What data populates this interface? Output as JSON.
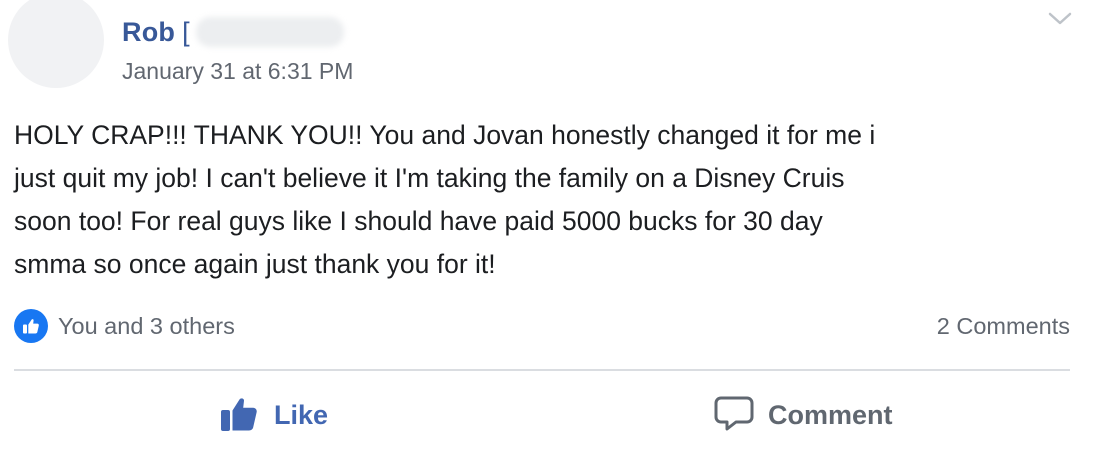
{
  "post": {
    "author_name": "Rob",
    "author_name_suffix": "[",
    "timestamp": "January 31 at 6:31 PM",
    "text": "HOLY CRAP!!! THANK YOU!! You and Jovan honestly changed it for me i\njust quit my job! I can't believe it I'm taking the family on a Disney Cruis\nsoon too! For real guys like I should have paid 5000 bucks for 30 day\nsmma so once again just thank you for it!",
    "reactions_text": "You and 3 others",
    "comments_count": "2 Comments"
  },
  "actions": {
    "like_label": "Like",
    "comment_label": "Comment"
  },
  "icons": {
    "menu": "chevron-down-icon",
    "reaction": "like-reaction-icon",
    "like": "thumbs-up-icon",
    "comment": "speech-bubble-icon"
  },
  "colors": {
    "author_link": "#385898",
    "muted_text": "#616770",
    "like_blue": "#4267b2",
    "reaction_badge": "#1877f2",
    "body_text": "#1c1e21",
    "divider": "#dadde1"
  }
}
